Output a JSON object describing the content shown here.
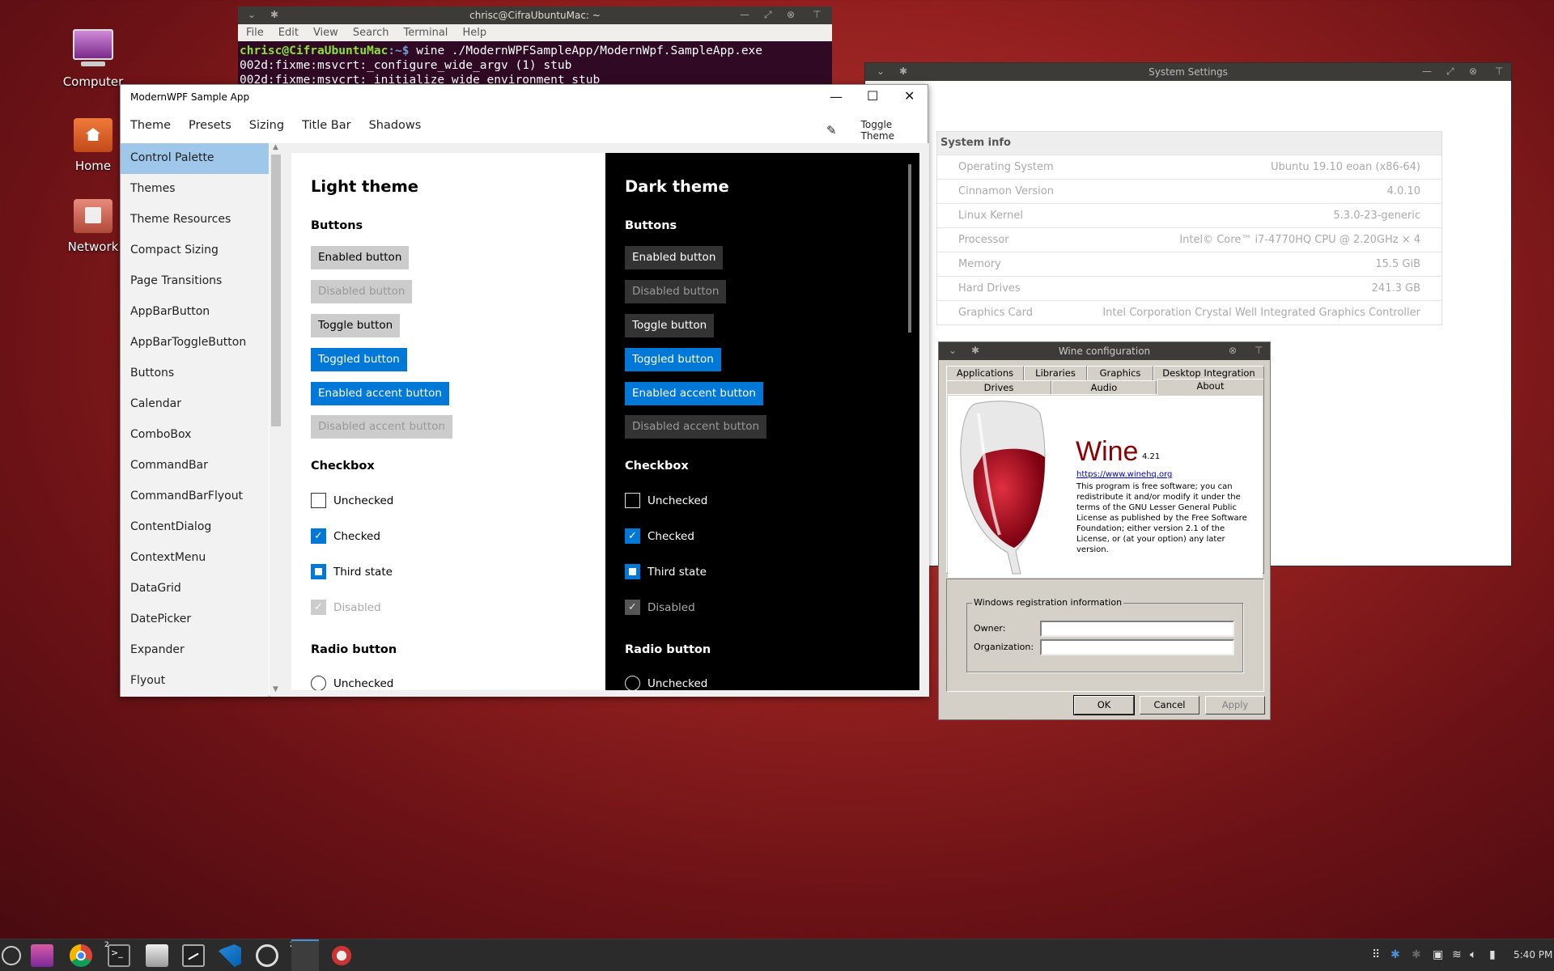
{
  "desktop": {
    "icons": [
      {
        "label": "Computer"
      },
      {
        "label": "Home"
      },
      {
        "label": "Network"
      }
    ]
  },
  "terminal": {
    "title": "chrisc@CifraUbuntuMac: ~",
    "menu": [
      "File",
      "Edit",
      "View",
      "Search",
      "Terminal",
      "Help"
    ],
    "prompt": "chrisc@CifraUbuntuMac",
    "path": ":~$",
    "command": " wine ./ModernWPFSampleApp/ModernWpf.SampleApp.exe",
    "lines": [
      "002d:fixme:msvcrt:_configure_wide_argv (1) stub",
      "002d:fixme:msvcrt:_initialize_wide_environment_stub"
    ]
  },
  "system_settings": {
    "title": "System Settings",
    "header": "System info",
    "rows": [
      {
        "label": "Operating System",
        "value": "Ubuntu 19.10 eoan (x86-64)"
      },
      {
        "label": "Cinnamon Version",
        "value": "4.0.10"
      },
      {
        "label": "Linux Kernel",
        "value": "5.3.0-23-generic"
      },
      {
        "label": "Processor",
        "value": "Intel© Core™ i7-4770HQ CPU @ 2.20GHz × 4"
      },
      {
        "label": "Memory",
        "value": "15.5 GiB"
      },
      {
        "label": "Hard Drives",
        "value": "241.3 GB"
      },
      {
        "label": "Graphics Card",
        "value": "Intel Corporation Crystal Well Integrated Graphics Controller"
      }
    ]
  },
  "wine": {
    "title": "Wine configuration",
    "tabs_row1": [
      "Applications",
      "Libraries",
      "Graphics",
      "Desktop Integration"
    ],
    "tabs_row2": [
      "Drives",
      "Audio",
      "About"
    ],
    "name": "Wine",
    "version": "4.21",
    "url": "https://www.winehq.org",
    "license": "This program is free software; you can redistribute it and/or modify it under the terms of the GNU Lesser General Public License as published by the Free Software Foundation; either version 2.1 of the License, or (at your option) any later version.",
    "reg_group": "Windows registration information",
    "owner_label": "Owner:",
    "org_label": "Organization:",
    "owner_value": "",
    "org_value": "",
    "ok": "OK",
    "cancel": "Cancel",
    "apply": "Apply"
  },
  "app": {
    "title": "ModernWPF Sample App",
    "menu": [
      "Theme",
      "Presets",
      "Sizing",
      "Title Bar",
      "Shadows"
    ],
    "toggle_theme": "Toggle Theme",
    "nav": [
      "Control Palette",
      "Themes",
      "Theme Resources",
      "Compact Sizing",
      "Page Transitions",
      "AppBarButton",
      "AppBarToggleButton",
      "Buttons",
      "Calendar",
      "ComboBox",
      "CommandBar",
      "CommandBarFlyout",
      "ContentDialog",
      "ContextMenu",
      "DataGrid",
      "DatePicker",
      "Expander",
      "Flyout"
    ],
    "light": {
      "title": "Light theme"
    },
    "dark": {
      "title": "Dark theme"
    },
    "sections": {
      "buttons": "Buttons",
      "checkbox": "Checkbox",
      "radio": "Radio button"
    },
    "buttons": {
      "enabled": "Enabled button",
      "disabled": "Disabled button",
      "toggle": "Toggle button",
      "toggled": "Toggled button",
      "accent": "Enabled accent button",
      "disabled_accent": "Disabled accent button"
    },
    "checkboxes": {
      "unchecked": "Unchecked",
      "checked": "Checked",
      "third": "Third state",
      "disabled": "Disabled"
    },
    "radios": {
      "unchecked": "Unchecked"
    }
  },
  "taskbar": {
    "time": "5:40 PM",
    "badge_terminal": "2",
    "badge_group": "2"
  },
  "colors": {
    "accent": "#0078d7",
    "selected_nav": "#9fc7ea",
    "wine_red": "#8b0000"
  }
}
